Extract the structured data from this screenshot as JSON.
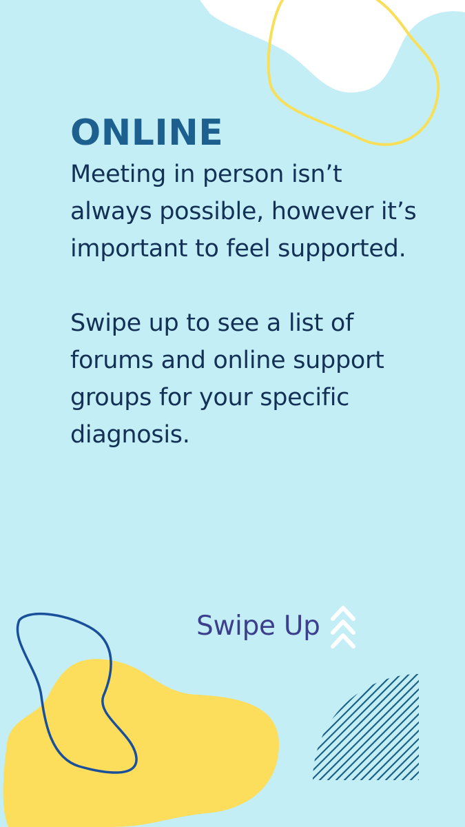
{
  "colors": {
    "background": "#c3eef6",
    "heading": "#1d6090",
    "body_text": "#123154",
    "swipe_text": "#3b3f8c",
    "yellow": "#fddd5c",
    "white": "#ffffff",
    "navy_outline": "#1a4f9a",
    "stripes": "#1b5f84"
  },
  "story": {
    "heading": "ONLINE",
    "paragraph_1": "Meeting in person isn’t always possible, however it’s important to feel supported.",
    "paragraph_2": "Swipe up to see a list of forums and online support groups for your specific diagnosis."
  },
  "swipe": {
    "label": "Swipe Up",
    "icon": "double-chevron-up-icon"
  }
}
